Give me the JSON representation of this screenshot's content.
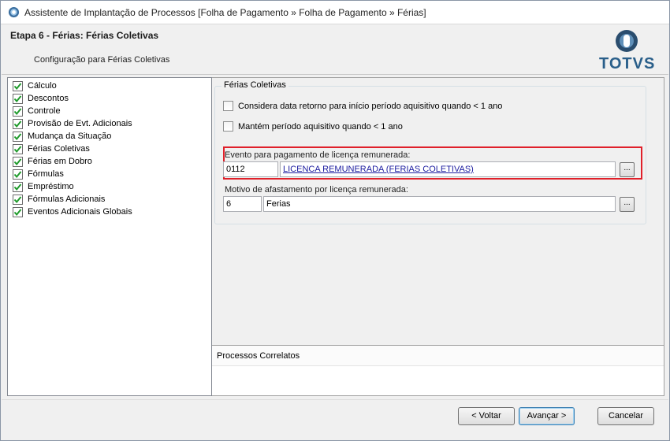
{
  "window": {
    "title": "Assistente de Implantação de Processos [Folha de Pagamento » Folha de Pagamento » Férias]"
  },
  "header": {
    "step_title": "Etapa 6 - Férias: Férias Coletivas",
    "step_subtitle": "Configuração para Férias Coletivas",
    "logo_text": "TOTVS"
  },
  "tree": {
    "items": [
      {
        "label": "Cálculo",
        "checked": true
      },
      {
        "label": "Descontos",
        "checked": true
      },
      {
        "label": "Controle",
        "checked": true
      },
      {
        "label": "Provisão de Evt. Adicionais",
        "checked": true
      },
      {
        "label": "Mudança da Situação",
        "checked": true
      },
      {
        "label": "Férias Coletivas",
        "checked": true
      },
      {
        "label": "Férias em Dobro",
        "checked": true
      },
      {
        "label": "Fórmulas",
        "checked": true
      },
      {
        "label": "Empréstimo",
        "checked": true
      },
      {
        "label": "Fórmulas Adicionais",
        "checked": true
      },
      {
        "label": "Eventos Adicionais Globais",
        "checked": true
      }
    ]
  },
  "form": {
    "group_title": "Férias Coletivas",
    "checkbox1_label": "Considera data retorno para início período aquisitivo quando < 1 ano",
    "checkbox1_checked": false,
    "checkbox2_label": "Mantém período aquisitivo quando < 1 ano",
    "checkbox2_checked": false,
    "evento_label": "Evento para pagamento de licença remunerada:",
    "evento_code": "0112",
    "evento_desc": "LICENCA REMUNERADA (FERIAS COLETIVAS)",
    "motivo_label": "Motivo de afastamento por licença remunerada:",
    "motivo_code": "6",
    "motivo_desc": "Ferias",
    "lookup_label": "..."
  },
  "correlatos": {
    "title": "Processos Correlatos"
  },
  "buttons": {
    "back": "< Voltar",
    "next": "Avançar >",
    "cancel": "Cancelar"
  },
  "colors": {
    "highlight": "#e0202a",
    "link": "#1c1ca0",
    "logo": "#2a5f8a"
  }
}
